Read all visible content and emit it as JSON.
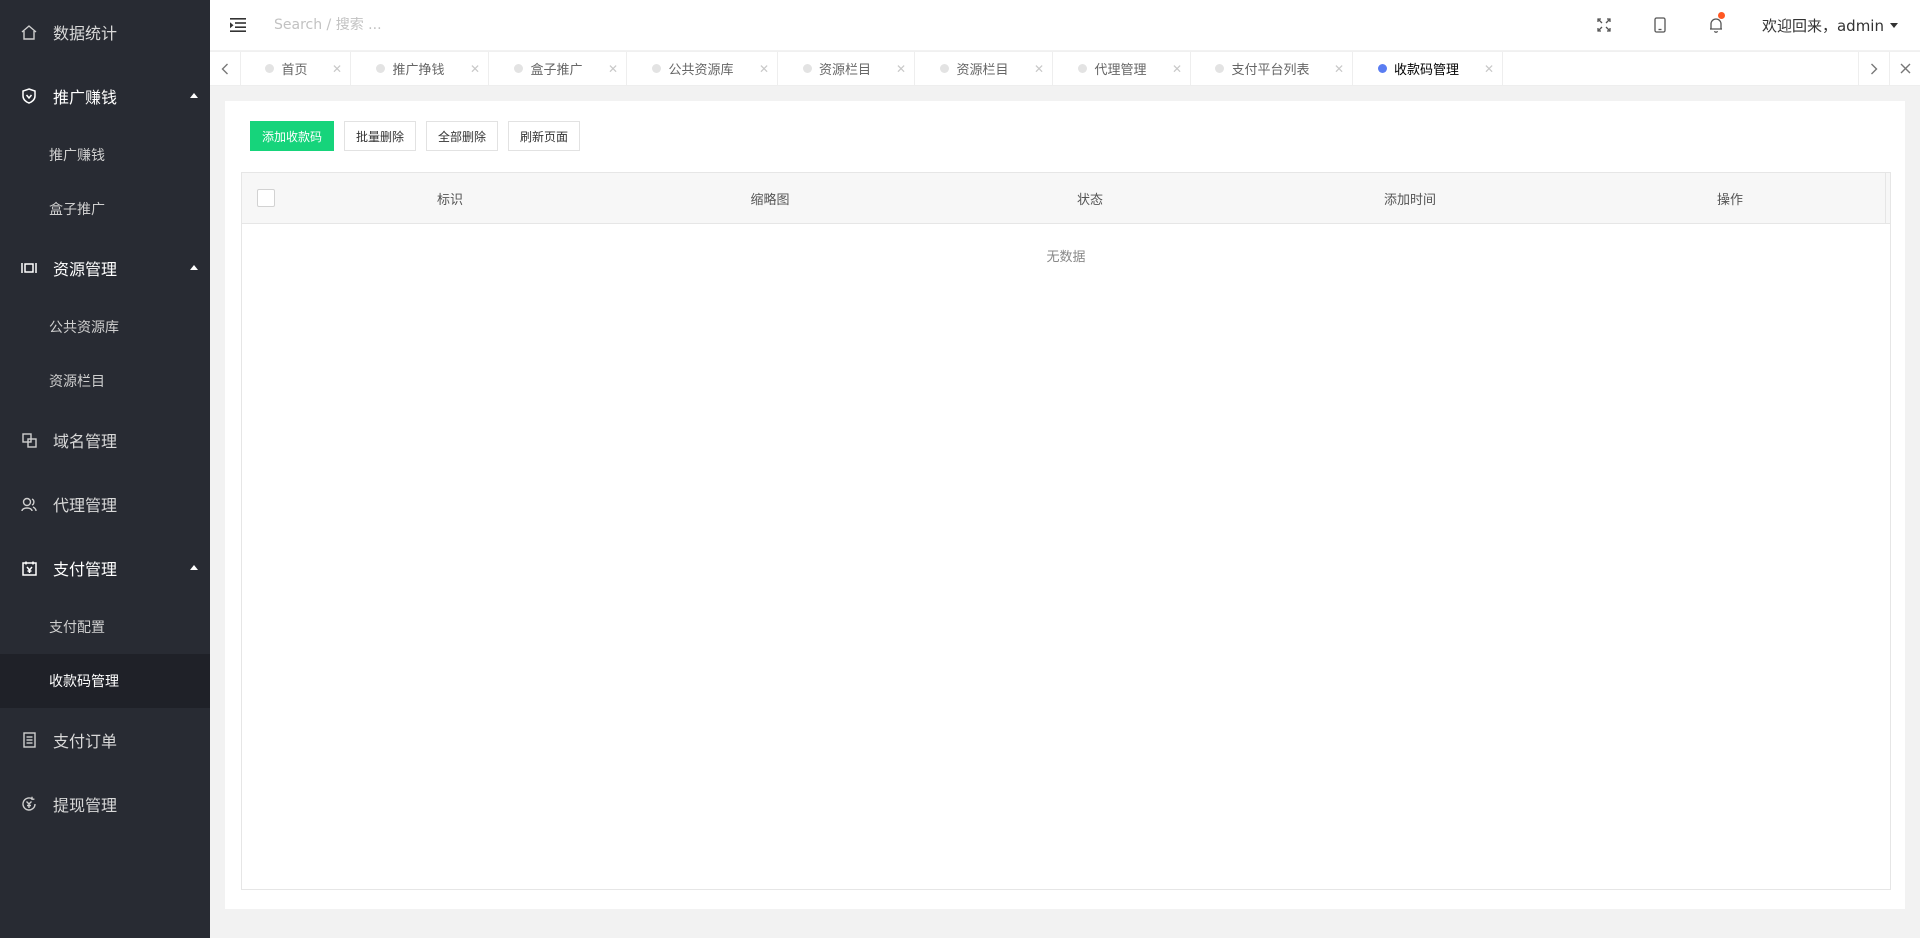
{
  "sidebar": {
    "items": [
      {
        "label": "数据统计",
        "icon": "home-icon",
        "open": false,
        "children": []
      },
      {
        "label": "推广赚钱",
        "icon": "shield-icon",
        "open": true,
        "children": [
          {
            "label": "推广赚钱",
            "active": false
          },
          {
            "label": "盒子推广",
            "active": false
          }
        ]
      },
      {
        "label": "资源管理",
        "icon": "resource-icon",
        "open": true,
        "children": [
          {
            "label": "公共资源库",
            "active": false
          },
          {
            "label": "资源栏目",
            "active": false
          }
        ]
      },
      {
        "label": "域名管理",
        "icon": "domain-icon",
        "open": false,
        "children": []
      },
      {
        "label": "代理管理",
        "icon": "users-icon",
        "open": false,
        "children": []
      },
      {
        "label": "支付管理",
        "icon": "payment-icon",
        "open": true,
        "children": [
          {
            "label": "支付配置",
            "active": false
          },
          {
            "label": "收款码管理",
            "active": true
          }
        ]
      },
      {
        "label": "支付订单",
        "icon": "order-icon",
        "open": false,
        "children": []
      },
      {
        "label": "提现管理",
        "icon": "withdraw-icon",
        "open": false,
        "children": []
      }
    ]
  },
  "header": {
    "search_placeholder": "Search / 搜索 ...",
    "welcome": "欢迎回来，admin",
    "icons": [
      "fullscreen-icon",
      "mobile-icon",
      "bell-icon"
    ]
  },
  "tabs": [
    {
      "label": "首页",
      "active": false,
      "width": 110
    },
    {
      "label": "推广挣钱",
      "active": false,
      "width": 138
    },
    {
      "label": "盒子推广",
      "active": false,
      "width": 138
    },
    {
      "label": "公共资源库",
      "active": false,
      "width": 151
    },
    {
      "label": "资源栏目",
      "active": false,
      "width": 137
    },
    {
      "label": "资源栏目",
      "active": false,
      "width": 138
    },
    {
      "label": "代理管理",
      "active": false,
      "width": 138
    },
    {
      "label": "支付平台列表",
      "active": false,
      "width": 162
    },
    {
      "label": "收款码管理",
      "active": true,
      "width": 150
    }
  ],
  "toolbar": {
    "add_label": "添加收款码",
    "batch_delete_label": "批量删除",
    "delete_all_label": "全部删除",
    "refresh_label": "刷新页面"
  },
  "table": {
    "columns": [
      "标识",
      "缩略图",
      "状态",
      "添加时间",
      "操作"
    ],
    "empty_text": "无数据"
  },
  "colors": {
    "sidebar_bg": "#282b33",
    "primary_button": "#16d47b",
    "active_tab_dot": "#5a7df2",
    "notification_dot": "#ff5722"
  }
}
